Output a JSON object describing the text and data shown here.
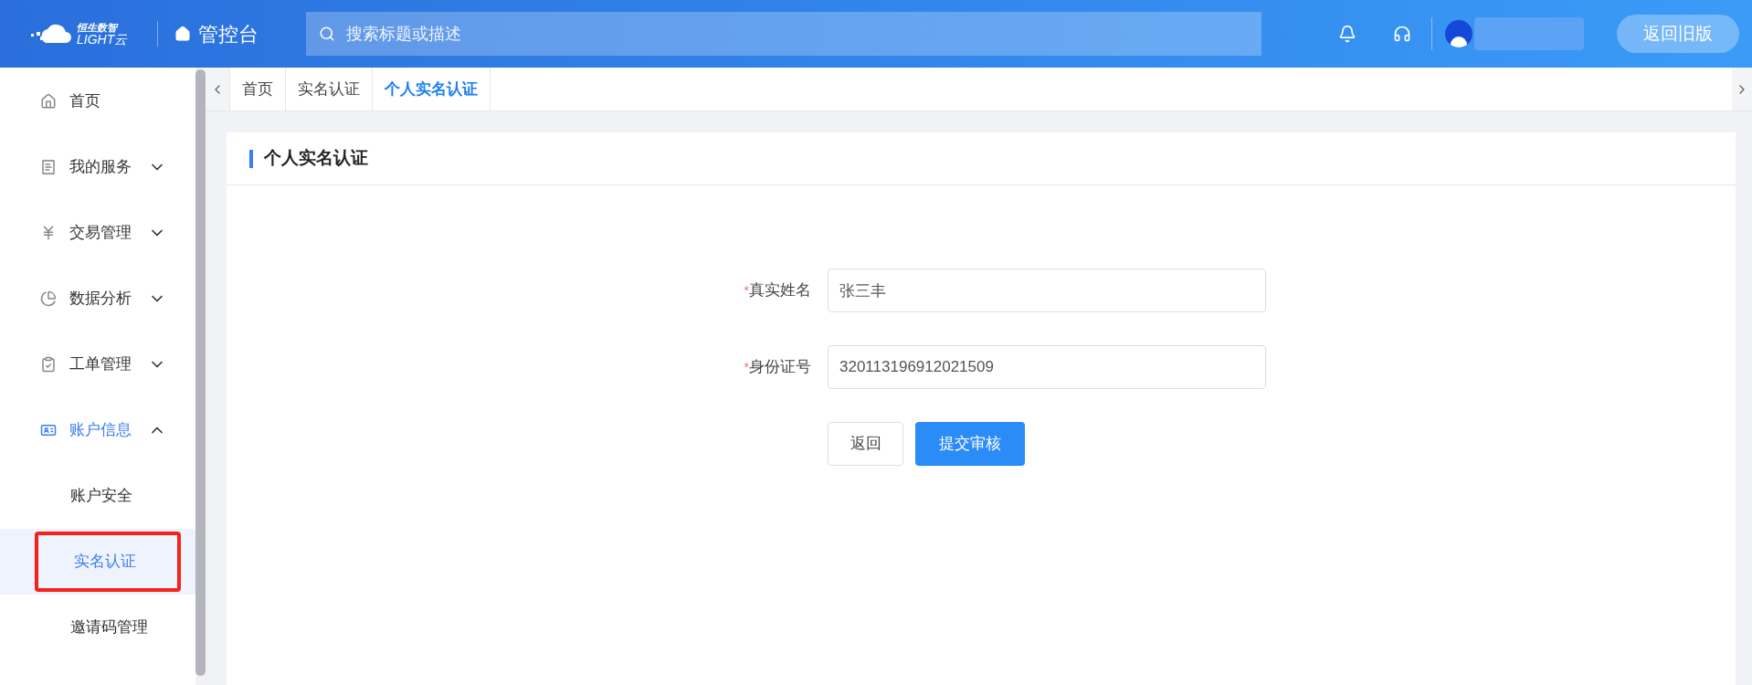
{
  "header": {
    "logo_top": "恒生数智",
    "logo_bottom": "LIGHT云",
    "console": "管控台",
    "search": {
      "placeholder": "搜索标题或描述"
    },
    "back_button": "返回旧版"
  },
  "sidebar": {
    "items": [
      {
        "label": "首页",
        "active": false
      },
      {
        "label": "我的服务",
        "expanded": false,
        "active": false
      },
      {
        "label": "交易管理",
        "expanded": false,
        "active": false
      },
      {
        "label": "数据分析",
        "expanded": false,
        "active": false
      },
      {
        "label": "工单管理",
        "expanded": false,
        "active": false
      },
      {
        "label": "账户信息",
        "expanded": true,
        "active": true,
        "children": [
          {
            "label": "账户安全",
            "selected": false,
            "highlighted": false
          },
          {
            "label": "实名认证",
            "selected": true,
            "highlighted": true
          },
          {
            "label": "邀请码管理",
            "selected": false,
            "highlighted": false
          }
        ]
      }
    ]
  },
  "tabs": [
    {
      "label": "首页",
      "selected": false
    },
    {
      "label": "实名认证",
      "selected": false
    },
    {
      "label": "个人实名认证",
      "selected": true
    }
  ],
  "card": {
    "title": "个人实名认证",
    "fields": [
      {
        "label": "真实姓名",
        "required_mark": "*",
        "value": "张三丰"
      },
      {
        "label": "身份证号",
        "required_mark": "*",
        "value": "320113196912021509"
      }
    ],
    "buttons": [
      {
        "label": "返回",
        "kind": "secondary"
      },
      {
        "label": "提交审核",
        "kind": "primary"
      }
    ]
  }
}
